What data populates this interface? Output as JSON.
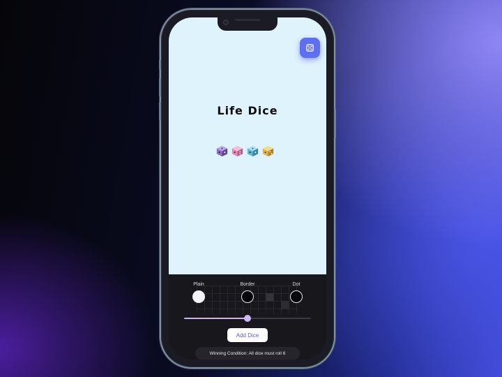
{
  "app": {
    "title": "Life Dice",
    "fab_icon": "dice-icon",
    "dice": [
      {
        "icon": "purple-dice-icon",
        "color": "#8b6fc0"
      },
      {
        "icon": "pink-dice-icon",
        "color": "#e58bb6"
      },
      {
        "icon": "blue-dice-icon",
        "color": "#5fb8d8"
      },
      {
        "icon": "gold-dice-icon",
        "color": "#e2b54a"
      }
    ]
  },
  "controls": {
    "styles": [
      {
        "label": "Plain"
      },
      {
        "label": "Border"
      },
      {
        "label": "Dot"
      }
    ],
    "slider_fraction": 0.5,
    "add_button_label": "Add Dice",
    "winning_condition": "Winning Condition: All dice must roll 6"
  },
  "colors": {
    "accent": "#5e6ff0",
    "screen_background": "#dff3fd",
    "panel_background": "#18171c",
    "slider": "#c6b3f2"
  }
}
